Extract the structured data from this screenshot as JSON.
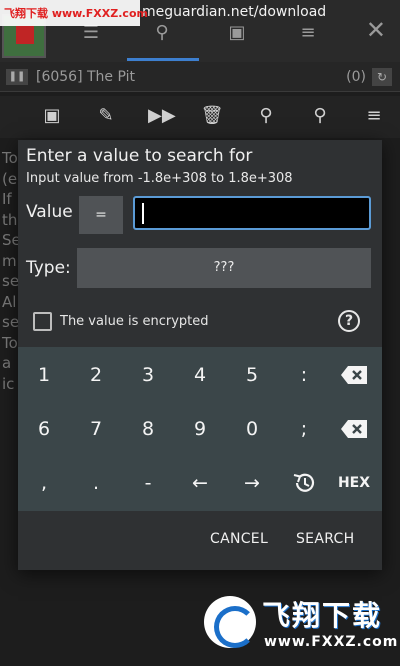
{
  "watermark_top": {
    "text": "飞翔下载 www.FXXZ.com"
  },
  "url_bar": {
    "text": "meguardian.net/download"
  },
  "process_bar": {
    "process": "[6056] The Pit",
    "count": "(0)"
  },
  "background_text": {
    "lines": [
      "To",
      "(e",
      "If",
      "th",
      "Se",
      "m",
      "se",
      "Al",
      "se",
      "To",
      "a",
      "ic"
    ]
  },
  "dialog": {
    "title": "Enter a value to search for",
    "subtitle": "Input value from -1.8e+308 to 1.8e+308",
    "value_label": "Value",
    "eq_label": "=",
    "value_input": "",
    "type_label": "Type:",
    "type_value": "???",
    "encrypted_label": "The value is encrypted",
    "help_symbol": "?",
    "keys_row1": [
      "1",
      "2",
      "3",
      "4",
      "5",
      ":"
    ],
    "keys_row2": [
      "6",
      "7",
      "8",
      "9",
      "0",
      ";"
    ],
    "keys_row3": [
      ",",
      ".",
      "-",
      "←",
      "→"
    ],
    "hex_label": "HEX",
    "cancel_label": "CANCEL",
    "search_label": "SEARCH"
  },
  "watermark_bottom": {
    "brand": "飞翔下载",
    "url": "www.FXXZ.com"
  },
  "colors": {
    "accent": "#5b9bd6",
    "dialog_bg": "#2f3133",
    "keypad_bg": "#3b4649"
  }
}
